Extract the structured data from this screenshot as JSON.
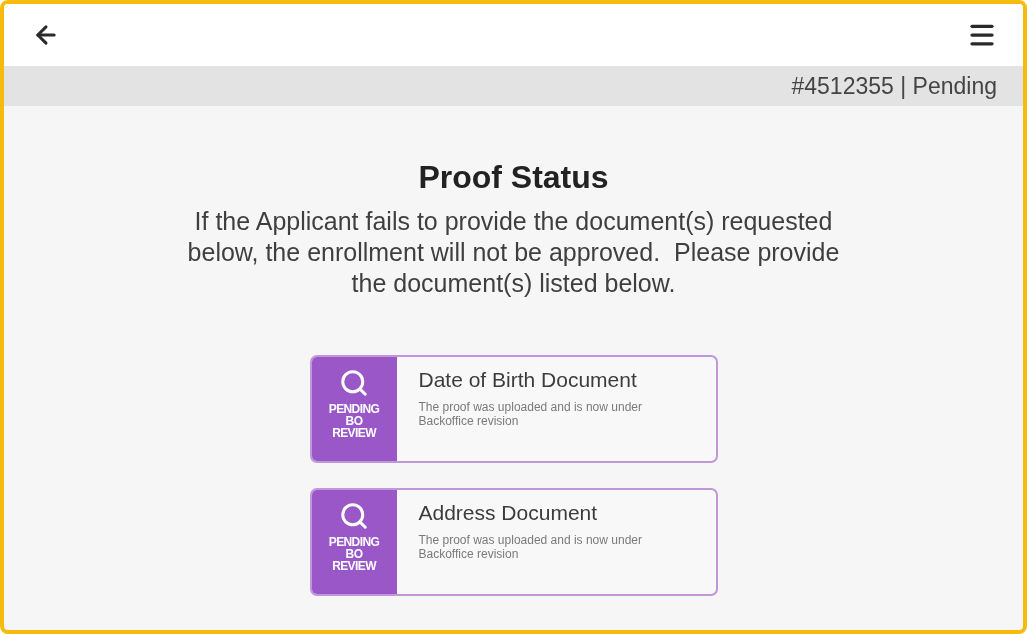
{
  "status_bar": {
    "text": "#4512355 | Pending"
  },
  "title": "Proof Status",
  "intro": "If the Applicant fails to provide the document(s) requested below, the enrollment will not be approved.  Please provide the document(s) listed below.",
  "proofs": [
    {
      "title": "Date of Birth Document",
      "description": "The proof was uploaded and is now under Backoffice revision",
      "status": {
        "kind": "pending_review",
        "label": "PENDING BO REVIEW"
      }
    },
    {
      "title": "Address Document",
      "description": "The proof was uploaded and is now under Backoffice revision",
      "status": {
        "kind": "pending_review",
        "label": "PENDING BO REVIEW"
      }
    }
  ]
}
